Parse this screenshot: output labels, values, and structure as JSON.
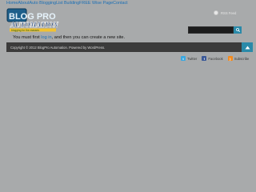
{
  "nav": {
    "links": [
      "Home",
      "About",
      "Auto Blogging",
      "List Building",
      "FREE Wise Page",
      "Contact"
    ]
  },
  "logo": {
    "line1": "BLOG PRO",
    "line2": "AUTOMATION",
    "tagline": "blogging for the masses"
  },
  "header": {
    "rss_label": "RSS Feed"
  },
  "search": {
    "value": ""
  },
  "content": {
    "message_prefix": "You must first ",
    "login_link": "log in",
    "message_suffix": ", and then you can create a new site."
  },
  "footer": {
    "copyright": "Copyright © 2012 BlogPro Automation. Powered by WordPress."
  },
  "social": {
    "twitter": "Twitter",
    "facebook": "Facebook",
    "subscribe": "Subscribe"
  },
  "colors": {
    "background": "#a8aaab",
    "link": "#1b6fb5",
    "accent": "#2a8aa9",
    "footer_bar": "#3b3b3b"
  }
}
